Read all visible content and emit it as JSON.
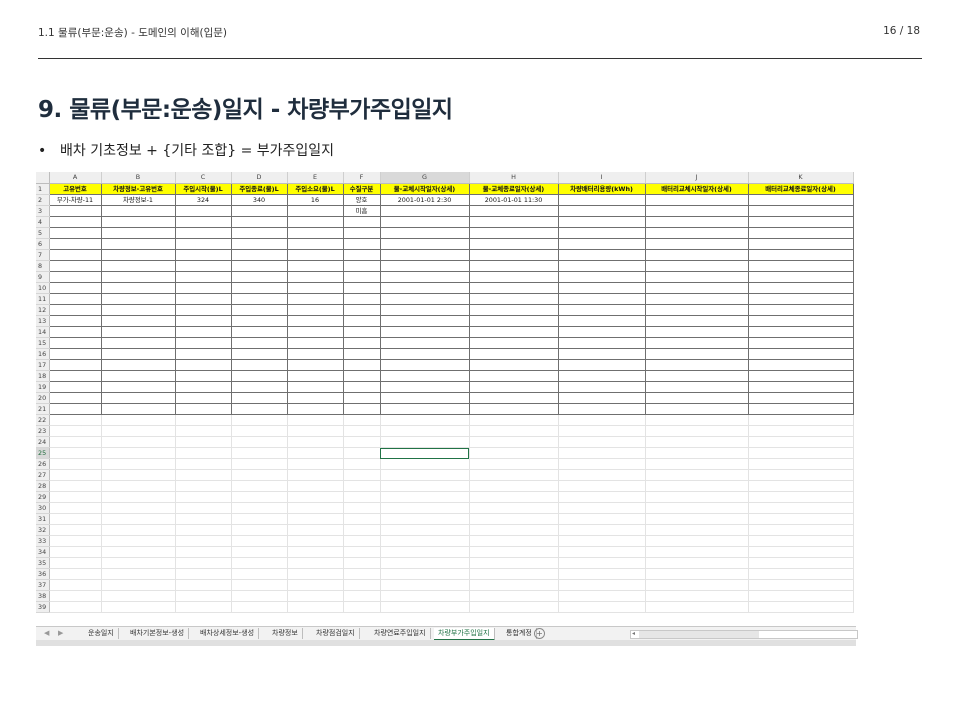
{
  "header": {
    "breadcrumb": "1.1 물류(부문:운송) - 도메인의 이해(입문)",
    "page_number": "16 / 18"
  },
  "title": "9. 물류(부문:운송)일지 - 차량부가주입일지",
  "bullet": "배차 기초정보 + {기타 조합} = 부가주입일지",
  "sheet": {
    "columns": [
      "A",
      "B",
      "C",
      "D",
      "E",
      "F",
      "G",
      "H",
      "I",
      "J",
      "K"
    ],
    "selected_column": "G",
    "selected_row": 25,
    "header_row": [
      "고유번호",
      "차량정보-고유번호",
      "주입시작(물)L",
      "주입종료(물)L",
      "주입소요(물)L",
      "수질구분",
      "물-교체시작일자(상세)",
      "물-교체종료일자(상세)",
      "차량배터리용량(kWh)",
      "배터리교체시작일자(상세)",
      "배터리교체종료일자(상세)"
    ],
    "rows": [
      [
        "부가-차량-11",
        "차량정보-1",
        "324",
        "340",
        "16",
        "양호",
        "2001-01-01 2:30",
        "2001-01-01 11:30",
        "",
        "",
        ""
      ],
      [
        "",
        "",
        "",
        "",
        "",
        "미흡",
        "",
        "",
        "",
        "",
        ""
      ]
    ],
    "row_count": 39,
    "bordered_rows_to": 21,
    "tabs": [
      "운송일지",
      "배차기본정보-생성",
      "배차상세정보-생성",
      "차량정보",
      "차량점검일지",
      "차량연료주입일지",
      "차량부가주입일지",
      "통합계정"
    ],
    "active_tab": "차량부가주입일지",
    "colors": {
      "header_fill": "#ffff00",
      "selection": "#217346"
    }
  }
}
